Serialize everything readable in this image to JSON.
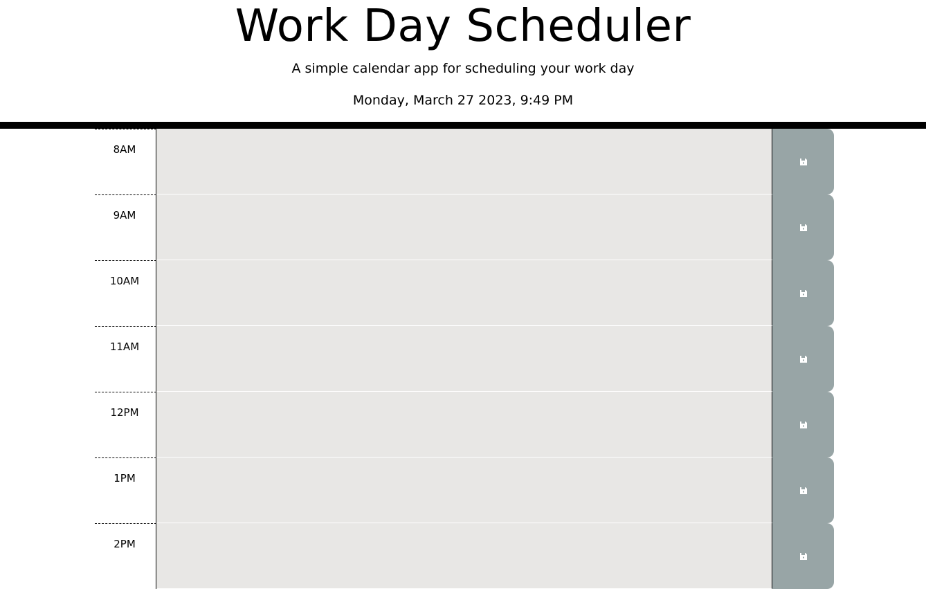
{
  "header": {
    "title": "Work Day Scheduler",
    "lead": "A simple calendar app for scheduling your work day",
    "current_day": "Monday, March 27 2023, 9:49 PM"
  },
  "time_blocks": [
    {
      "hour": "8AM",
      "description": ""
    },
    {
      "hour": "9AM",
      "description": ""
    },
    {
      "hour": "10AM",
      "description": ""
    },
    {
      "hour": "11AM",
      "description": ""
    },
    {
      "hour": "12PM",
      "description": ""
    },
    {
      "hour": "1PM",
      "description": ""
    },
    {
      "hour": "2PM",
      "description": ""
    }
  ],
  "icons": {
    "save": "save-icon"
  },
  "colors": {
    "past_block": "#e8e7e5",
    "save_button": "#98a5a6",
    "divider": "#000000"
  }
}
